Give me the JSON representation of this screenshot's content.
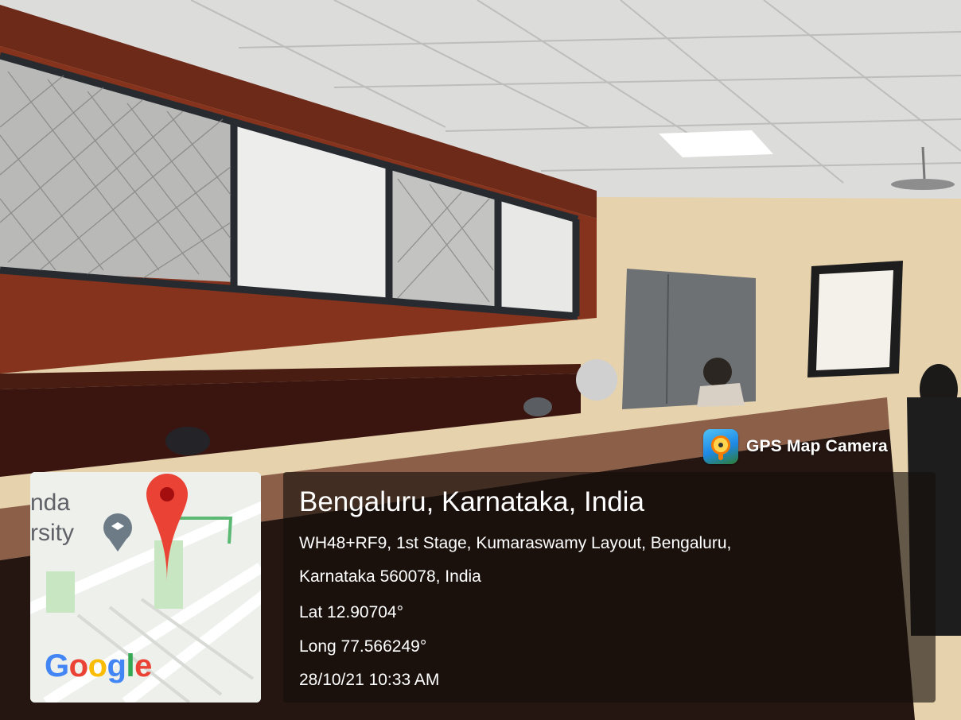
{
  "overlay": {
    "app_label": "GPS Map Camera",
    "app_icon": "gps-map-camera-icon",
    "map": {
      "place_fragment_line1": "nda",
      "place_fragment_line2": "rsity",
      "logo": [
        "G",
        "o",
        "o",
        "g",
        "l",
        "e"
      ],
      "pin_color": "#ea4335",
      "poi_icon": "university-icon"
    },
    "location_title": "Bengaluru, Karnataka, India",
    "address_line1": "WH48+RF9, 1st Stage, Kumaraswamy Layout, Bengaluru,",
    "address_line2": "Karnataka 560078, India",
    "latitude": "Lat 12.90704°",
    "longitude": "Long 77.566249°",
    "datetime": "28/10/21 10:33 AM"
  },
  "scene_colors": {
    "wall": "#e8d3ad",
    "band": "#7a2e1a",
    "ceiling": "#e9e9e7",
    "counter": "#8a5c45"
  }
}
